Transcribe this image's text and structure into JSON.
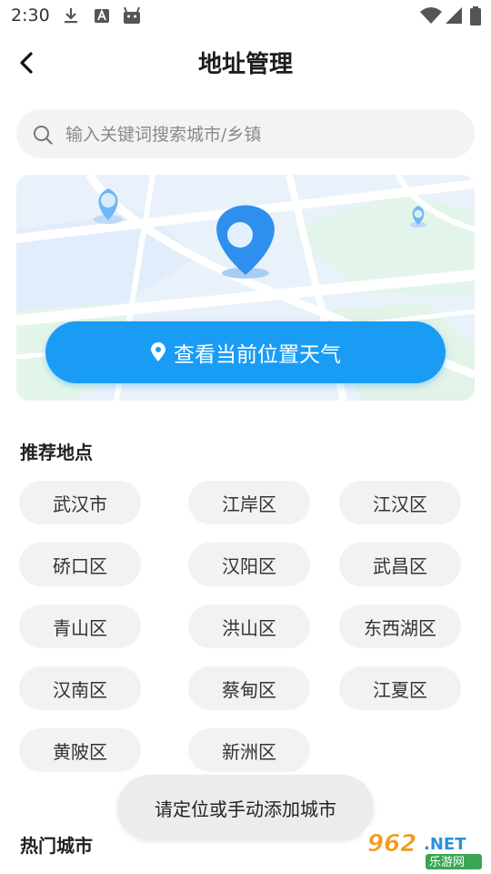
{
  "status_bar": {
    "time": "2:30",
    "left_icons": [
      "download-icon",
      "font-a-icon",
      "android-icon"
    ],
    "right_icons": [
      "wifi-icon",
      "cellular-signal-icon",
      "battery-icon"
    ]
  },
  "header": {
    "title": "地址管理",
    "back_icon": "chevron-left-icon"
  },
  "search": {
    "placeholder": "输入关键词搜索城市/乡镇"
  },
  "map_card": {
    "button_label": "查看当前位置天气",
    "button_icon": "location-pin-icon",
    "accent_color": "#1a9cf5"
  },
  "recommended": {
    "title": "推荐地点",
    "places": [
      "武汉市",
      "江岸区",
      "江汉区",
      "硚口区",
      "汉阳区",
      "武昌区",
      "青山区",
      "洪山区",
      "东西湖区",
      "汉南区",
      "蔡甸区",
      "江夏区",
      "黄陂区",
      "新洲区"
    ]
  },
  "hot_cities": {
    "title": "热门城市"
  },
  "toast": {
    "message": "请定位或手动添加城市"
  },
  "watermark": {
    "number": "962",
    "suffix": ".NET",
    "caption": "乐游网"
  }
}
